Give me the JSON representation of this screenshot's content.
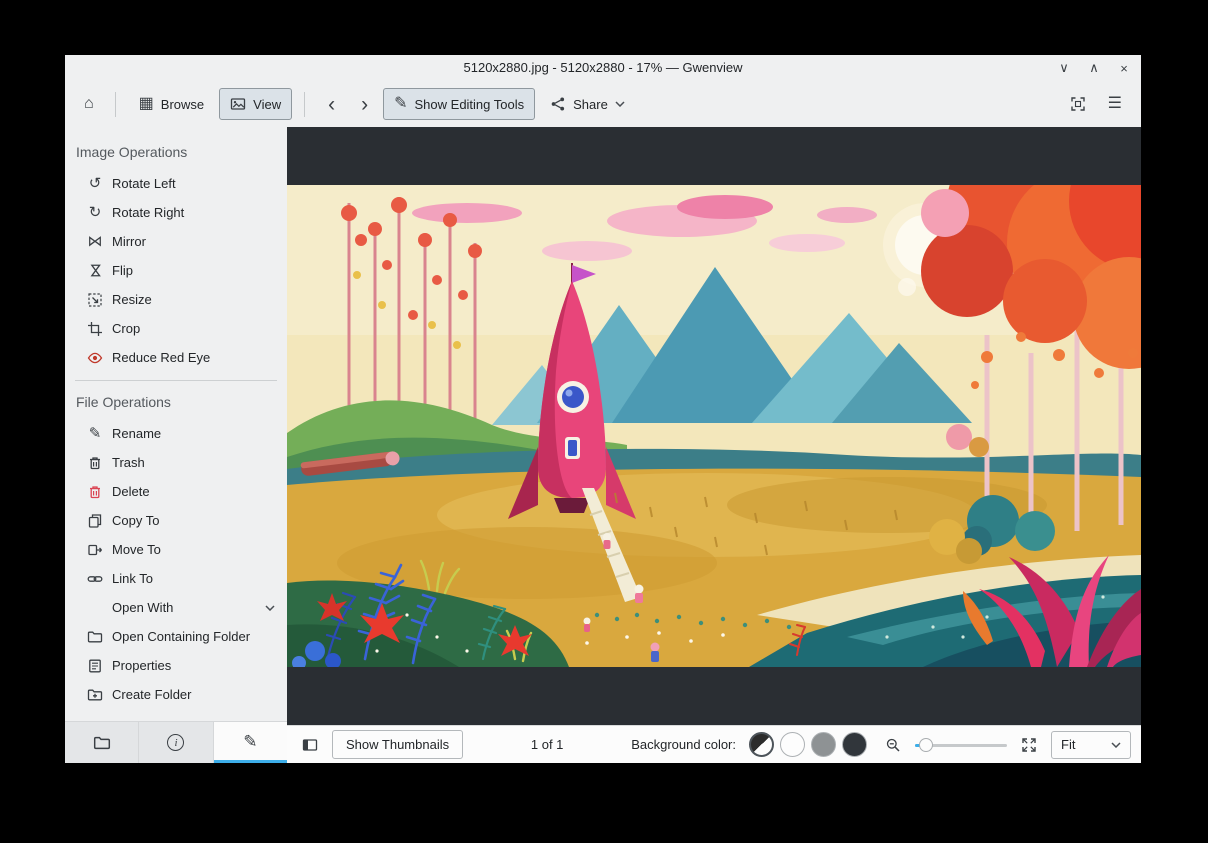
{
  "window": {
    "title": "5120x2880.jpg - 5120x2880 - 17% — Gwenview"
  },
  "icons": {
    "minimize": "∨",
    "maximize": "∧",
    "close": "×",
    "home": "⌂",
    "browse": "▦",
    "back": "‹",
    "forward": "›",
    "pencil": "✎",
    "hamburger": "☰",
    "rotate_left": "↺",
    "rotate_right": "↻",
    "mirror": "⋈",
    "flip": "⋈",
    "info": "i"
  },
  "toolbar": {
    "browse": "Browse",
    "view": "View",
    "show_editing_tools": "Show Editing Tools",
    "share": "Share"
  },
  "sidebar": {
    "sections": [
      {
        "header": "Image Operations",
        "items": [
          {
            "label": "Rotate Left"
          },
          {
            "label": "Rotate Right"
          },
          {
            "label": "Mirror"
          },
          {
            "label": "Flip"
          },
          {
            "label": "Resize"
          },
          {
            "label": "Crop"
          },
          {
            "label": "Reduce Red Eye"
          }
        ]
      },
      {
        "header": "File Operations",
        "items": [
          {
            "label": "Rename"
          },
          {
            "label": "Trash"
          },
          {
            "label": "Delete"
          },
          {
            "label": "Copy To"
          },
          {
            "label": "Move To"
          },
          {
            "label": "Link To"
          },
          {
            "label": "Open With"
          },
          {
            "label": "Open Containing Folder"
          },
          {
            "label": "Properties"
          },
          {
            "label": "Create Folder"
          }
        ]
      }
    ]
  },
  "statusbar": {
    "show_thumbnails": "Show Thumbnails",
    "position": "1 of 1",
    "background_color_label": "Background color:",
    "zoom_mode": "Fit"
  },
  "colors": {
    "accent": "#3daee9",
    "danger": "#da4453",
    "canvas_background": "#2a2e33",
    "swatch_white": "#fdfdfd",
    "swatch_gray": "#8e9294",
    "swatch_dark": "#31363b"
  }
}
